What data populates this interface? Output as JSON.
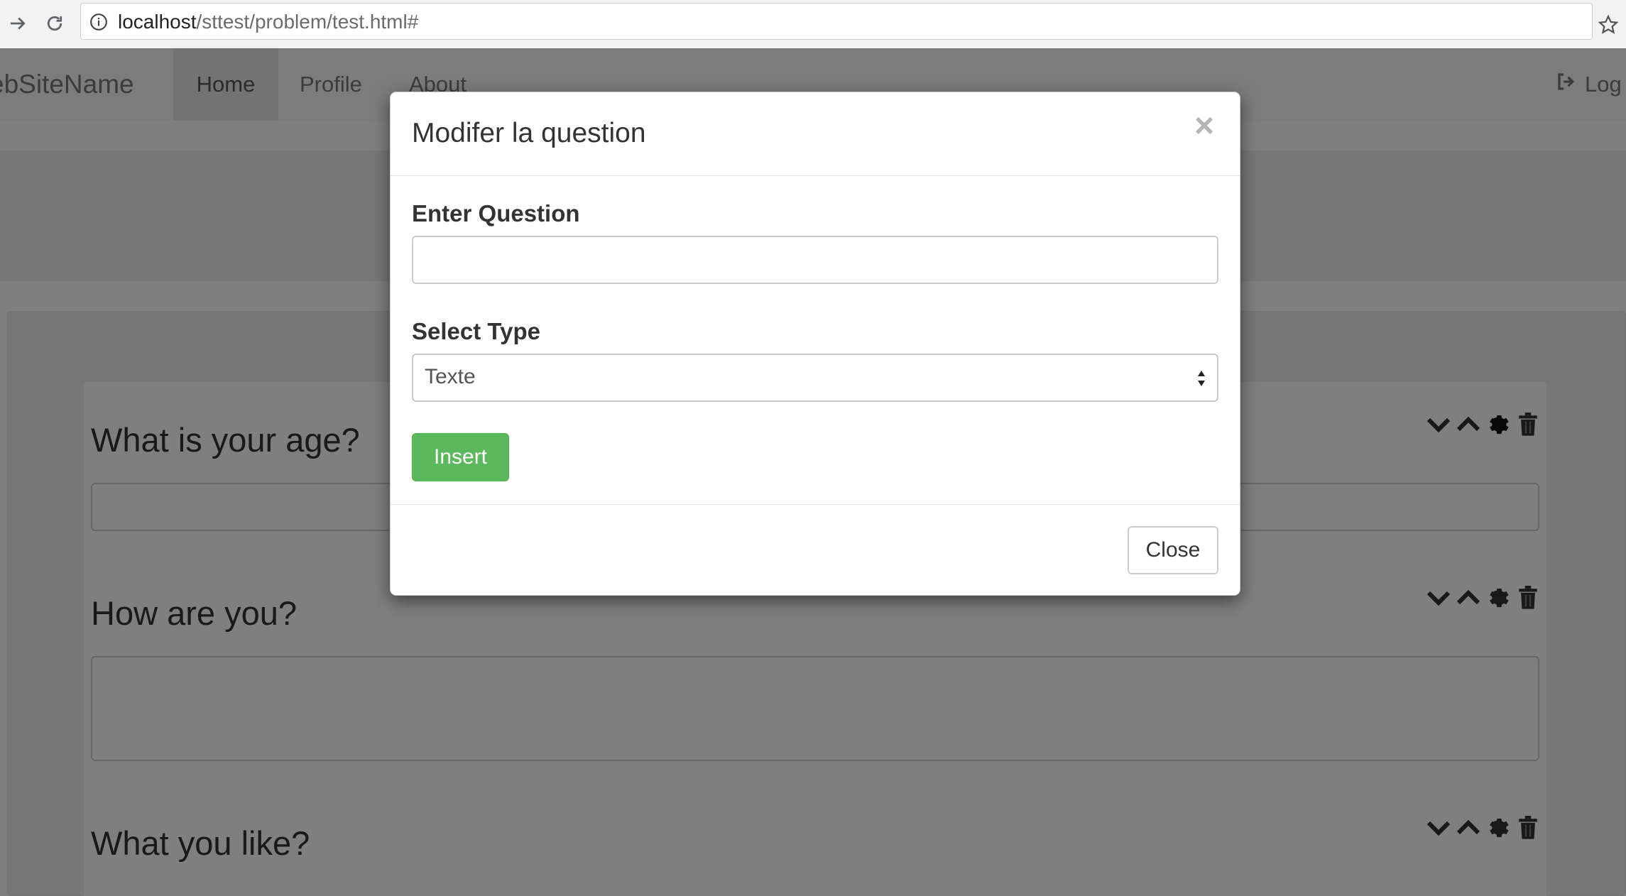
{
  "browser": {
    "url_host": "localhost",
    "url_path": "/sttest/problem/test.html#"
  },
  "navbar": {
    "brand": "ebSiteName",
    "items": [
      {
        "label": "Home",
        "active": true
      },
      {
        "label": "Profile",
        "active": false
      },
      {
        "label": "About",
        "active": false
      }
    ],
    "logout_label": "Log"
  },
  "questions": [
    {
      "title": "What is your age?"
    },
    {
      "title": "How are you?"
    },
    {
      "title": "What you like?"
    }
  ],
  "modal": {
    "title": "Modifer la question",
    "question_label": "Enter Question",
    "question_value": "",
    "type_label": "Select Type",
    "type_selected": "Texte",
    "insert_label": "Insert",
    "close_label": "Close",
    "close_icon": "×"
  },
  "colors": {
    "insert_green": "#5cb85c",
    "backdrop": "rgba(0,0,0,0.5)"
  }
}
